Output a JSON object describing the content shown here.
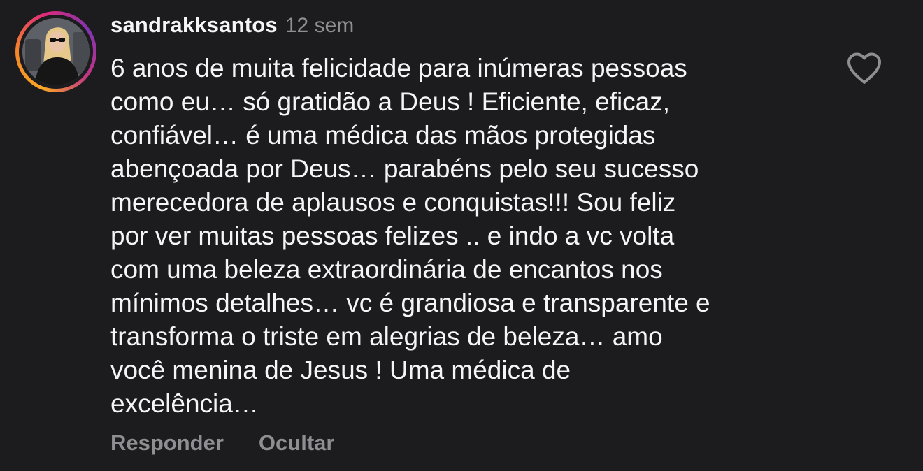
{
  "comment": {
    "username": "sandrakksantos",
    "time": "12 sem",
    "text_lines": [
      "6 anos de muita felicidade para inúmeras pessoas",
      "como eu… só gratidão a Deus ! Eficiente, eficaz,",
      "confiável… é uma médica das mãos protegidas",
      "abençoada por Deus… parabéns pelo seu sucesso",
      "merecedora de aplausos e conquistas!!! Sou feliz",
      "por ver muitas pessoas felizes .. e indo a vc volta",
      "com uma beleza extraordinária de encantos nos",
      "mínimos detalhes… vc é grandiosa e transparente e",
      "transforma o triste em alegrias de beleza… amo",
      "você menina de Jesus ! Uma médica de",
      "excelência…"
    ],
    "actions": {
      "reply": "Responder",
      "hide": "Ocultar"
    },
    "like_icon": "heart-outline-icon",
    "avatar_ring": "story-ring",
    "colors": {
      "background": "#1c1c1e",
      "text": "#f5f5f7",
      "secondary": "#8e8e93",
      "ring_start": "#f9a825",
      "ring_end": "#c13584"
    }
  }
}
